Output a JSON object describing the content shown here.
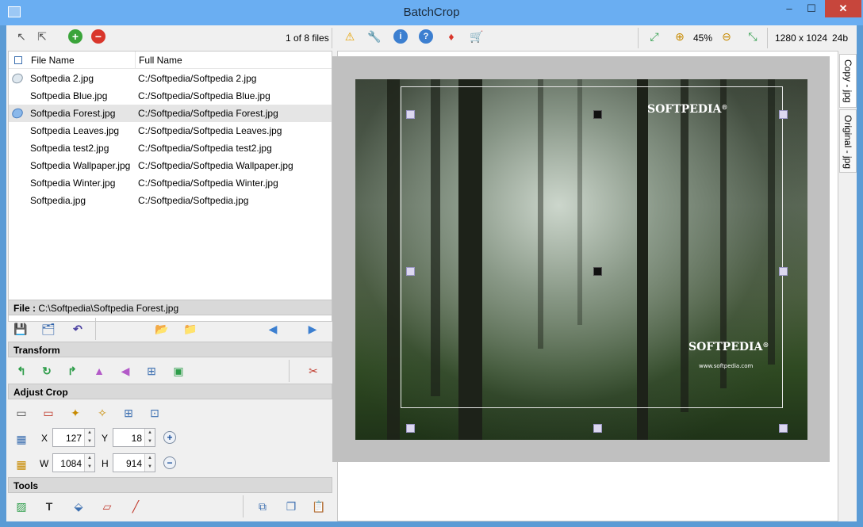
{
  "window": {
    "title": "BatchCrop",
    "minimize": "–",
    "maximize": "☐",
    "close": "✕"
  },
  "toolbar": {
    "file_count": "1 of 8 files",
    "zoom": "45%",
    "dimensions": "1280 x 1024",
    "bit_depth": "24b"
  },
  "file_list": {
    "headers": {
      "file_name": "File Name",
      "full_name": "Full Name"
    },
    "rows": [
      {
        "name": "Softpedia 2.jpg",
        "path": "C:/Softpedia/Softpedia 2.jpg"
      },
      {
        "name": "Softpedia Blue.jpg",
        "path": "C:/Softpedia/Softpedia Blue.jpg"
      },
      {
        "name": "Softpedia Forest.jpg",
        "path": "C:/Softpedia/Softpedia Forest.jpg"
      },
      {
        "name": "Softpedia Leaves.jpg",
        "path": "C:/Softpedia/Softpedia Leaves.jpg"
      },
      {
        "name": "Softpedia test2.jpg",
        "path": "C:/Softpedia/Softpedia test2.jpg"
      },
      {
        "name": "Softpedia Wallpaper.jpg",
        "path": "C:/Softpedia/Softpedia Wallpaper.jpg"
      },
      {
        "name": "Softpedia Winter.jpg",
        "path": "C:/Softpedia/Softpedia Winter.jpg"
      },
      {
        "name": "Softpedia.jpg",
        "path": "C:/Softpedia/Softpedia.jpg"
      }
    ]
  },
  "file_bar": {
    "label": "File :",
    "path": "C:\\Softpedia\\Softpedia Forest.jpg"
  },
  "sections": {
    "transform": "Transform",
    "adjust_crop": "Adjust Crop",
    "tools": "Tools"
  },
  "crop": {
    "x_label": "X",
    "x": "127",
    "y_label": "Y",
    "y": "18",
    "w_label": "W",
    "w": "1084",
    "h_label": "H",
    "h": "914",
    "plus": "+",
    "minus": "−"
  },
  "preview": {
    "watermark_top": "SOFTPEDIA",
    "watermark_mark": "®",
    "watermark_bottom": "SOFTPEDIA",
    "watermark_url": "www.softpedia.com"
  },
  "side_tabs": {
    "copy": "Copy - jpg",
    "original": "Original - jpg"
  },
  "icons": [
    "pointer-icon",
    "multi-select-icon",
    "add-icon",
    "remove-icon",
    "warning-icon",
    "wrench-icon",
    "info-icon",
    "help-icon",
    "gem-icon",
    "cart-icon",
    "fit-icon",
    "zoom-in-icon",
    "zoom-out-icon",
    "actual-size-icon",
    "save-icon",
    "save-all-icon",
    "undo-icon",
    "open-folder-icon",
    "folder-icon",
    "prev-icon",
    "next-icon",
    "rotate-left-icon",
    "rotate-right-icon",
    "redo-icon",
    "flip-horizontal-icon",
    "flip-vertical-icon",
    "center-icon",
    "export-icon",
    "cut-icon",
    "pen-icon",
    "eraser-icon",
    "text-icon"
  ],
  "colors": {
    "titlebar": "#6aaef2",
    "close": "#c7463c",
    "panel": "#f0f0f0",
    "preview_bg": "#c0c0c0"
  }
}
